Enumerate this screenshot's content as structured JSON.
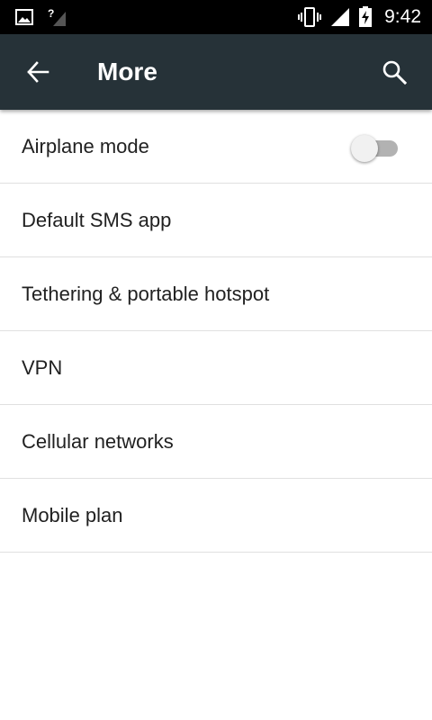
{
  "status_bar": {
    "time": "9:42",
    "icons": [
      "image-notification-icon",
      "signal-unknown-icon",
      "vibrate-icon",
      "cell-signal-icon",
      "battery-charging-icon"
    ]
  },
  "toolbar": {
    "title": "More",
    "back_icon": "arrow-back-icon",
    "search_icon": "search-icon",
    "background": "#263238"
  },
  "settings": {
    "items": [
      {
        "label": "Airplane mode",
        "has_toggle": true,
        "toggle_on": false
      },
      {
        "label": "Default SMS app"
      },
      {
        "label": "Tethering & portable hotspot"
      },
      {
        "label": "VPN"
      },
      {
        "label": "Cellular networks"
      },
      {
        "label": "Mobile plan"
      }
    ]
  }
}
